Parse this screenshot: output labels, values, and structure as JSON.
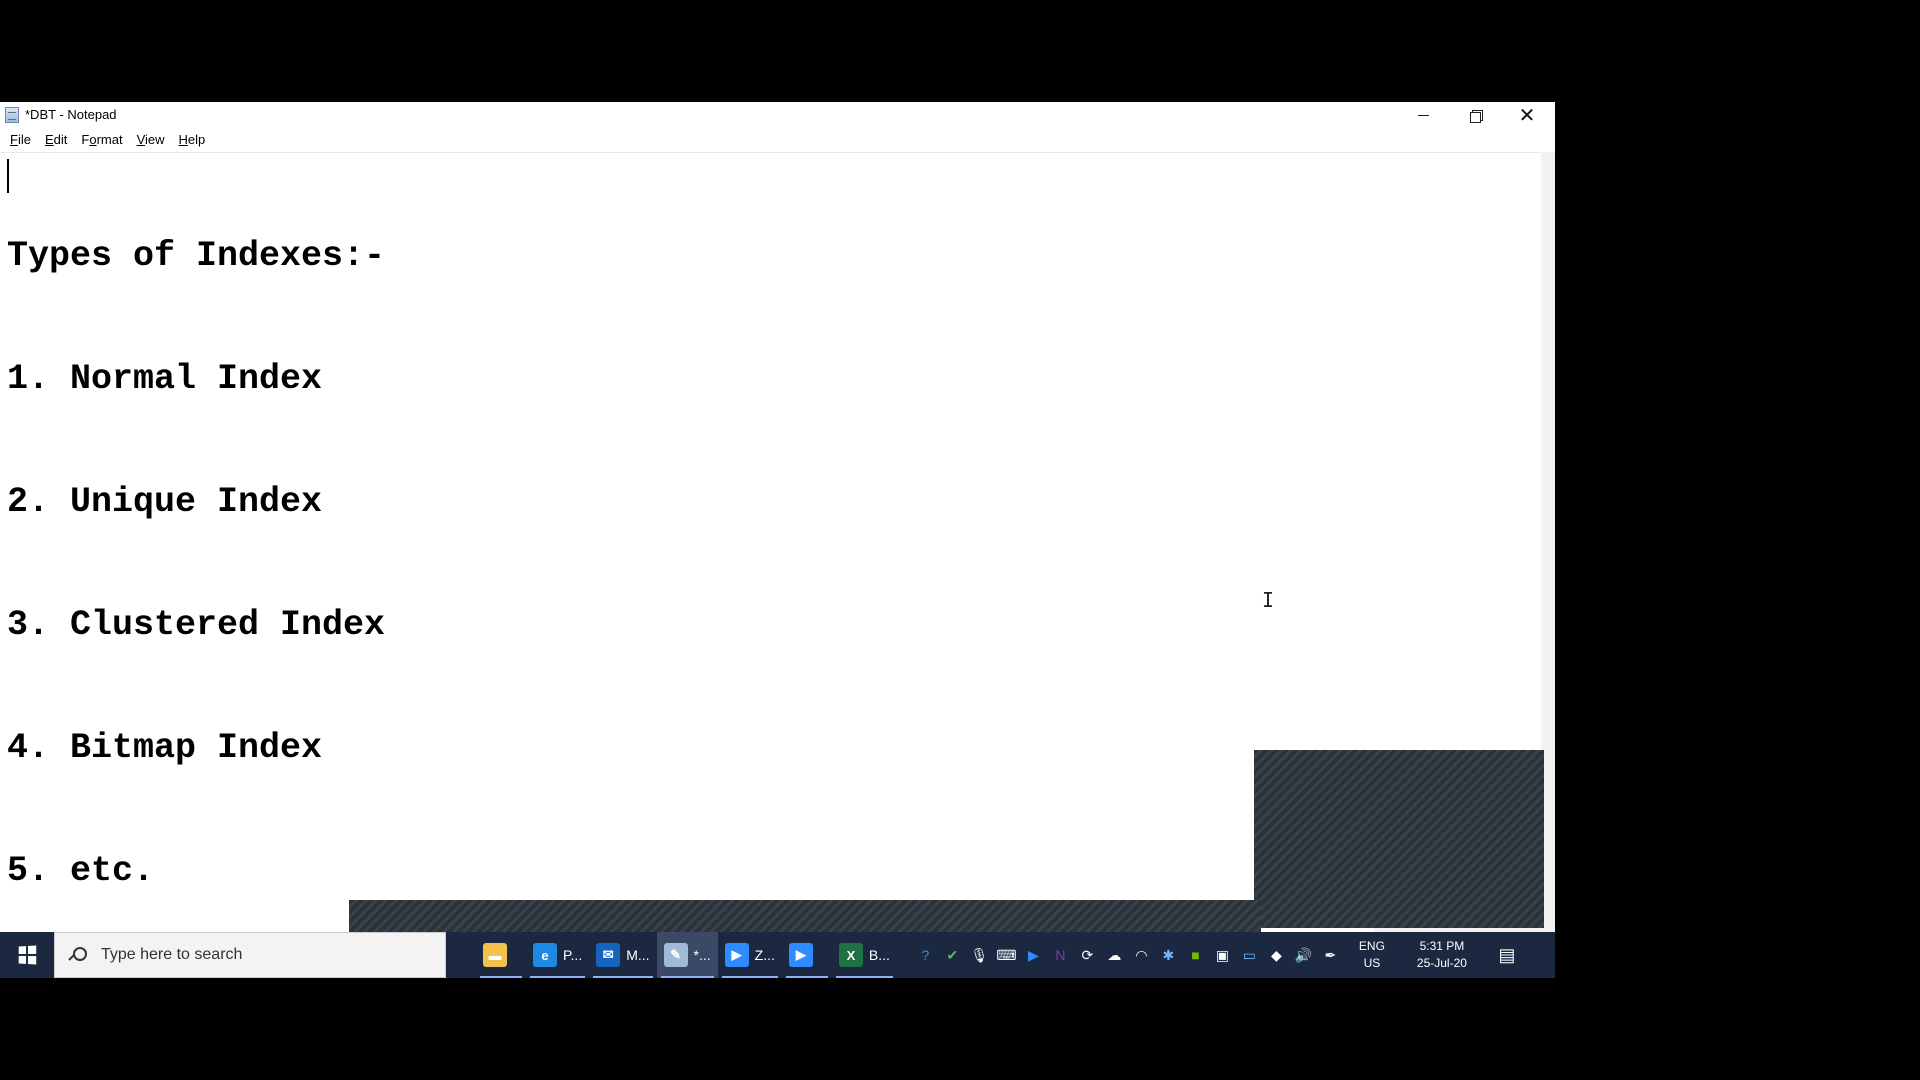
{
  "window": {
    "title": "*DBT - Notepad",
    "controls": {
      "minimize_icon": "minimize-icon",
      "maximize_icon": "restore-icon",
      "close_glyph": "✕"
    }
  },
  "menu": {
    "items": [
      {
        "label": "File",
        "mnemonic": "F",
        "rest": "ile"
      },
      {
        "label": "Edit",
        "mnemonic": "E",
        "rest": "dit"
      },
      {
        "label": "Format",
        "mnemonic": "o",
        "rest": "",
        "pre": "F",
        "post": "rmat"
      },
      {
        "label": "View",
        "mnemonic": "V",
        "rest": "iew"
      },
      {
        "label": "Help",
        "mnemonic": "H",
        "rest": "elp"
      }
    ]
  },
  "document": {
    "lines": [
      "Types of Indexes:-",
      "1. Normal Index",
      "2. Unique Index",
      "3. Clustered Index",
      "4. Bitmap Index",
      "5. etc."
    ]
  },
  "cursor": {
    "glyph": "I"
  },
  "taskbar": {
    "search_placeholder": "Type here to search",
    "apps": [
      {
        "name": "file-explorer",
        "label": "",
        "color": "#f2c14e",
        "glyph": "▬"
      },
      {
        "name": "edge",
        "label": "P...",
        "color": "#1e88e5",
        "glyph": "e"
      },
      {
        "name": "mail",
        "label": "M...",
        "color": "#1565c0",
        "glyph": "✉"
      },
      {
        "name": "notepad",
        "label": "*...",
        "color": "#9fbbd8",
        "glyph": "✎"
      },
      {
        "name": "zoom-meeting",
        "label": "Z...",
        "color": "#2d8cff",
        "glyph": "▶"
      },
      {
        "name": "zoom",
        "label": "",
        "color": "#2d8cff",
        "glyph": "▶"
      },
      {
        "name": "excel",
        "label": "B...",
        "color": "#1e7145",
        "glyph": "X"
      }
    ],
    "tray_icons": [
      {
        "name": "help",
        "glyph": "?",
        "color": "#2d8cff"
      },
      {
        "name": "shield",
        "glyph": "✔",
        "color": "#5cb85c"
      },
      {
        "name": "microphone",
        "glyph": "🎙",
        "color": "#ffffff"
      },
      {
        "name": "keyboard",
        "glyph": "⌨",
        "color": "#ffffff"
      },
      {
        "name": "camera",
        "glyph": "▶",
        "color": "#2d8cff"
      },
      {
        "name": "onenote",
        "glyph": "N",
        "color": "#7b3fa0"
      },
      {
        "name": "sync",
        "glyph": "⟳",
        "color": "#ffffff"
      },
      {
        "name": "cloud",
        "glyph": "☁",
        "color": "#ffffff"
      },
      {
        "name": "wifi",
        "glyph": "◠",
        "color": "#ffffff"
      },
      {
        "name": "bluetooth",
        "glyph": "✱",
        "color": "#6fb7ff"
      },
      {
        "name": "nvidia",
        "glyph": "■",
        "color": "#76b900"
      },
      {
        "name": "storage",
        "glyph": "▣",
        "color": "#ffffff"
      },
      {
        "name": "display",
        "glyph": "▭",
        "color": "#6fb7ff"
      },
      {
        "name": "app",
        "glyph": "◆",
        "color": "#ffffff"
      },
      {
        "name": "volume",
        "glyph": "🔊",
        "color": "#ffffff"
      },
      {
        "name": "pen",
        "glyph": "✒",
        "color": "#ffffff"
      }
    ],
    "language": {
      "line1": "ENG",
      "line2": "US"
    },
    "clock": {
      "time": "5:31 PM",
      "date": "25-Jul-20"
    },
    "notification_glyph": "▤"
  }
}
